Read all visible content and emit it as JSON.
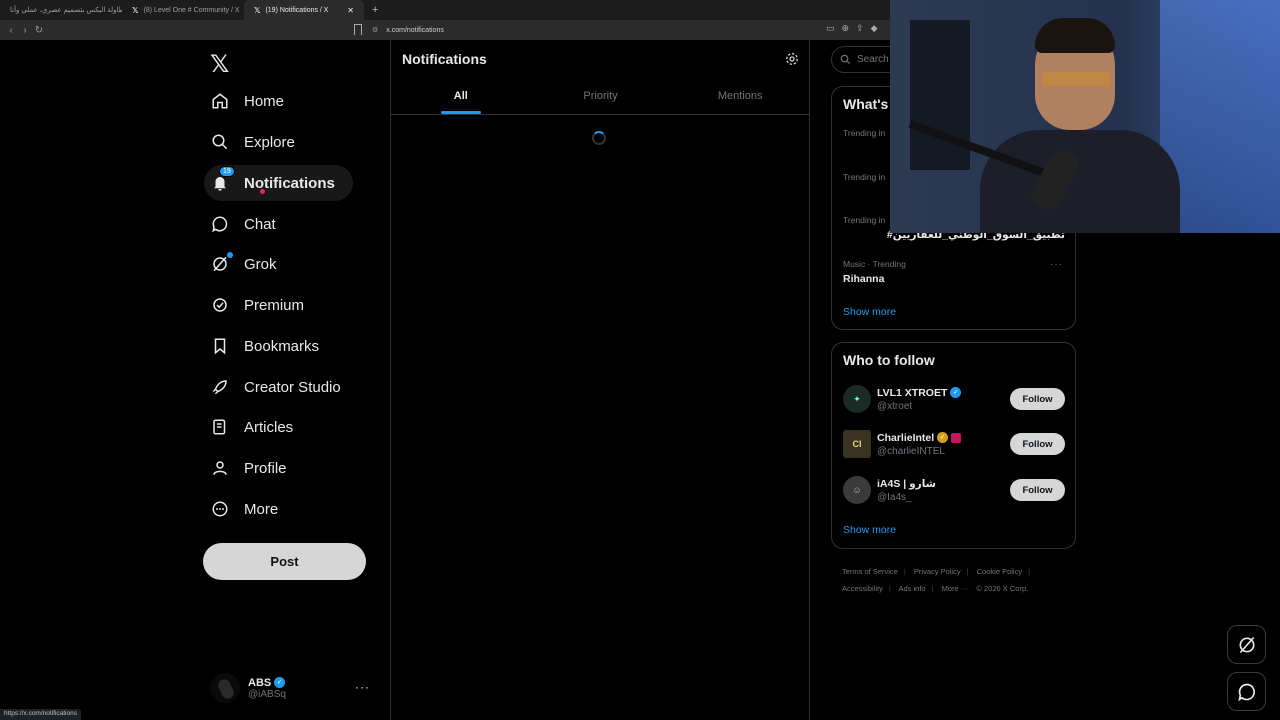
{
  "browser": {
    "tabs": [
      {
        "title": "طاولة اليكس بتصميم عصري، عملي وأنا"
      },
      {
        "title": "(8) Level One # Community / X"
      },
      {
        "title": "(19) Notifications / X"
      }
    ],
    "new_tab": "+",
    "url": "x.com/notifications",
    "status_url": "https://x.com/notifications"
  },
  "nav": {
    "items": [
      {
        "label": "Home",
        "icon": "home-icon"
      },
      {
        "label": "Explore",
        "icon": "search-icon"
      },
      {
        "label": "Notifications",
        "icon": "bell-icon",
        "badge": "19"
      },
      {
        "label": "Chat",
        "icon": "chat-icon"
      },
      {
        "label": "Grok",
        "icon": "grok-icon"
      },
      {
        "label": "Premium",
        "icon": "premium-icon"
      },
      {
        "label": "Bookmarks",
        "icon": "bookmark-icon"
      },
      {
        "label": "Creator Studio",
        "icon": "rocket-icon"
      },
      {
        "label": "Articles",
        "icon": "article-icon"
      },
      {
        "label": "Profile",
        "icon": "user-icon"
      },
      {
        "label": "More",
        "icon": "more-circle-icon"
      }
    ],
    "post_label": "Post",
    "account": {
      "name": "ABS",
      "handle": "@iABSq"
    }
  },
  "main": {
    "title": "Notifications",
    "tabs": [
      {
        "label": "All",
        "active": true
      },
      {
        "label": "Priority",
        "active": false
      },
      {
        "label": "Mentions",
        "active": false
      }
    ]
  },
  "sidebar": {
    "search_placeholder": "Search",
    "trends_title": "What's happening",
    "trends": [
      {
        "meta": "Trending in",
        "name": ""
      },
      {
        "meta": "Trending in",
        "name": ""
      },
      {
        "meta": "Trending in",
        "name": "#تطبيق_السوق_الوطني_للعقاريين"
      },
      {
        "meta": "Music · Trending",
        "name": "Rihanna"
      }
    ],
    "trends_show_more": "Show more",
    "follow_title": "Who to follow",
    "who_to_follow": [
      {
        "name": "LVL1 XTROET",
        "handle": "@xtroet",
        "button": "Follow"
      },
      {
        "name": "CharlieIntel",
        "handle": "@charlieINTEL",
        "button": "Follow"
      },
      {
        "name": "iA4S | شارو",
        "handle": "@Ia4s_",
        "button": "Follow"
      }
    ],
    "follow_show_more": "Show more",
    "footer": [
      "Terms of Service",
      "Privacy Policy",
      "Cookie Policy",
      "Accessibility",
      "Ads info",
      "More ···",
      "© 2026 X Corp."
    ]
  },
  "colors": {
    "accent": "#1d9bf0",
    "background": "#000000",
    "border": "#2f3336",
    "muted": "#71767b"
  }
}
